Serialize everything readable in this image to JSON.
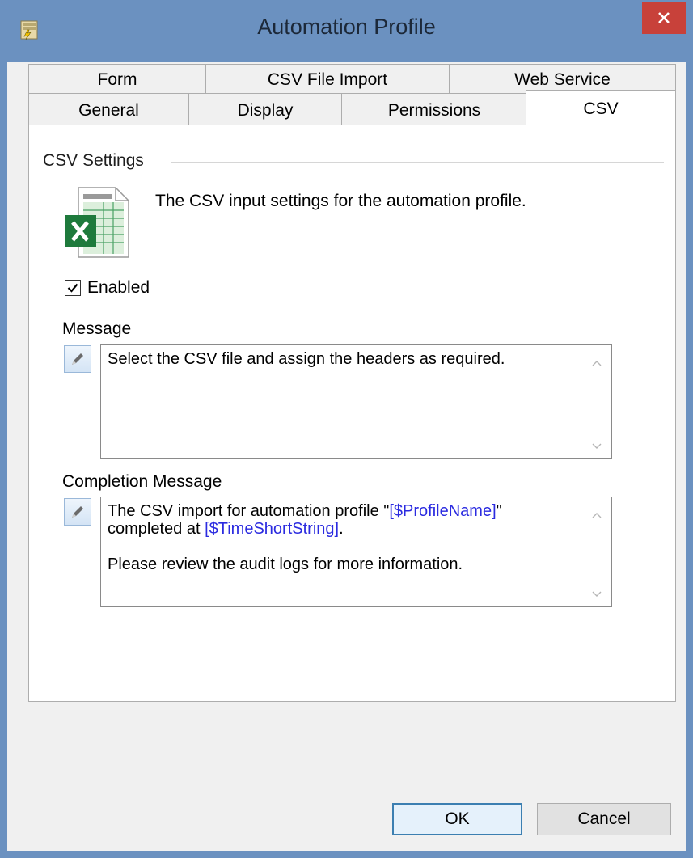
{
  "window": {
    "title": "Automation Profile"
  },
  "tabs": {
    "row1": [
      {
        "label": "Form"
      },
      {
        "label": "CSV File Import"
      },
      {
        "label": "Web Service"
      }
    ],
    "row2": [
      {
        "label": "General"
      },
      {
        "label": "Display"
      },
      {
        "label": "Permissions"
      },
      {
        "label": "CSV",
        "active": true
      }
    ]
  },
  "section": {
    "title": "CSV Settings",
    "description": "The CSV input settings for the automation profile.",
    "icon": "excel-csv-icon"
  },
  "enabled": {
    "label": "Enabled",
    "checked": true
  },
  "message": {
    "label": "Message",
    "text": "Select the CSV file and assign the headers as required."
  },
  "completion": {
    "label": "Completion Message",
    "line1_prefix": "The CSV import for automation profile \"",
    "line1_var": "[$ProfileName]",
    "line1_suffix": "\"",
    "line2_prefix": "completed at ",
    "line2_var": "[$TimeShortString]",
    "line2_suffix": ".",
    "line3": "Please review the audit logs for more information."
  },
  "buttons": {
    "ok": "OK",
    "cancel": "Cancel"
  },
  "colors": {
    "titlebar": "#6b91c0",
    "close": "#c8413a",
    "variable": "#2b2be0",
    "ok_border": "#3c7fb1"
  }
}
